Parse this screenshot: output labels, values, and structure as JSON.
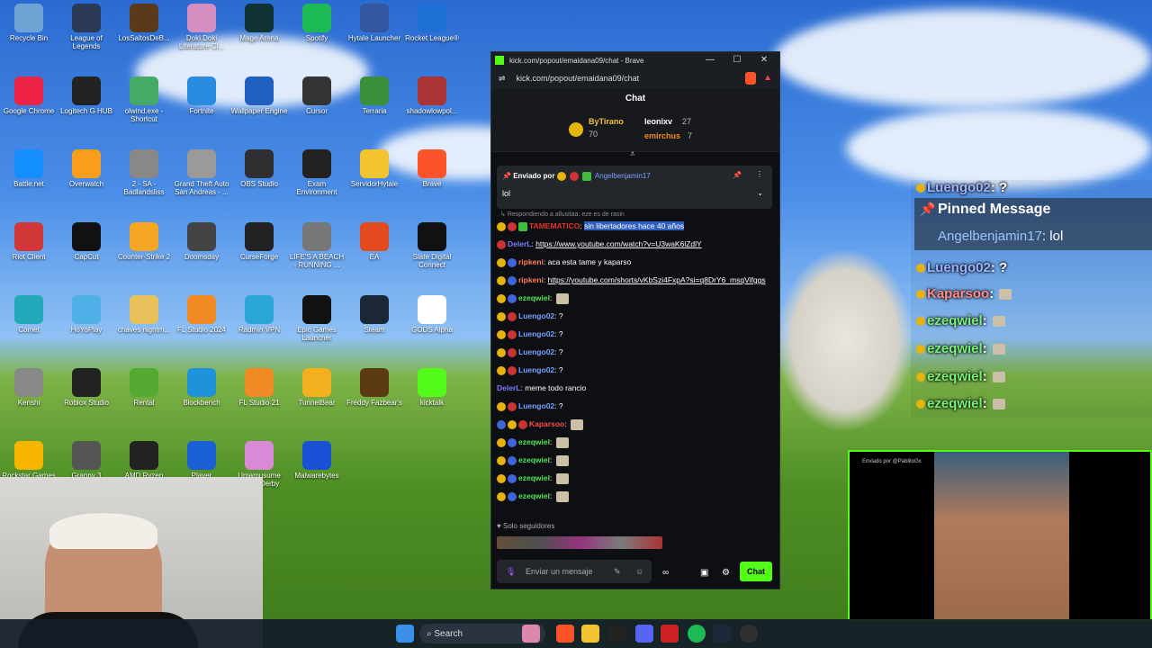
{
  "desktop": {
    "icons": [
      {
        "label": "Recycle Bin",
        "color": "#6fa3d6"
      },
      {
        "label": "League of Legends",
        "color": "#2b3b55"
      },
      {
        "label": "LosSaltosDeB...",
        "color": "#5b3a1a"
      },
      {
        "label": "Doki Doki Literature Cl...",
        "color": "#d48fc0"
      },
      {
        "label": "Mage Arena",
        "color": "#133"
      },
      {
        "label": "Spotify",
        "color": "#1db954"
      },
      {
        "label": "Hytale Launcher",
        "color": "#3557a0"
      },
      {
        "label": "Rocket League®",
        "color": "#1e6fd6"
      },
      {
        "label": "Google Chrome",
        "color": "#e24"
      },
      {
        "label": "Logitech G HUB",
        "color": "#222"
      },
      {
        "label": "olwind.exe - Shortcut",
        "color": "#4a6"
      },
      {
        "label": "Fortnite",
        "color": "#2a8ce0"
      },
      {
        "label": "Wallpaper Engine",
        "color": "#1f5fbf"
      },
      {
        "label": "Cursor",
        "color": "#333"
      },
      {
        "label": "Terraria",
        "color": "#3a8f3a"
      },
      {
        "label": "shadowlowpol...",
        "color": "#a33"
      },
      {
        "label": "Battle.net",
        "color": "#148eff"
      },
      {
        "label": "Overwatch",
        "color": "#f99e1a"
      },
      {
        "label": "2 - SA - Badlandsliss",
        "color": "#888"
      },
      {
        "label": "Grand Theft Auto San Andreas - ...",
        "color": "#9a9a9a"
      },
      {
        "label": "OBS Studio",
        "color": "#302e31"
      },
      {
        "label": "Exam Environment",
        "color": "#222"
      },
      {
        "label": "ServidorHytale",
        "color": "#f4c430"
      },
      {
        "label": "Brave",
        "color": "#fb542b"
      },
      {
        "label": "Riot Client",
        "color": "#d13639"
      },
      {
        "label": "CapCut",
        "color": "#111"
      },
      {
        "label": "Counter-Strike 2",
        "color": "#f5a623"
      },
      {
        "label": "Doomsday",
        "color": "#444"
      },
      {
        "label": "CurseForge",
        "color": "#222"
      },
      {
        "label": "LIFE'S A BEACH - RUNNING ...",
        "color": "#777"
      },
      {
        "label": "EA",
        "color": "#e34a1d"
      },
      {
        "label": "Slate Digital Connect",
        "color": "#111"
      },
      {
        "label": "Comet",
        "color": "#2ab"
      },
      {
        "label": "HoYoPlay",
        "color": "#4fb0e8"
      },
      {
        "label": "chaves nightm...",
        "color": "#e8c15a"
      },
      {
        "label": "FL Studio 2024",
        "color": "#f08a24"
      },
      {
        "label": "Radmin VPN",
        "color": "#2aa7d9"
      },
      {
        "label": "Epic Games Launcher",
        "color": "#111"
      },
      {
        "label": "Steam",
        "color": "#1b2838"
      },
      {
        "label": "GODS Alpha",
        "color": "#fff"
      },
      {
        "label": "Kenshi",
        "color": "#888"
      },
      {
        "label": "Roblox Studio",
        "color": "#222"
      },
      {
        "label": "Rental",
        "color": "#5a3"
      },
      {
        "label": "Blockbench",
        "color": "#1e93d9"
      },
      {
        "label": "FL Studio 21",
        "color": "#f08a24"
      },
      {
        "label": "TunnelBear",
        "color": "#f2b01e"
      },
      {
        "label": "Freddy Fazbear's",
        "color": "#5a3b12"
      },
      {
        "label": "kicktalk",
        "color": "#53fc18"
      },
      {
        "label": "Rockstar Games Launcher",
        "color": "#f7b500"
      },
      {
        "label": "Granny 3",
        "color": "#555"
      },
      {
        "label": "AMD Ryzen Master",
        "color": "#222"
      },
      {
        "label": "Player",
        "color": "#1a5fd6"
      },
      {
        "label": "Umamusume Pretty Derby",
        "color": "#d98ad6"
      },
      {
        "label": "Malwarebytes",
        "color": "#1a4fd6"
      }
    ]
  },
  "taskbar": {
    "search_placeholder": "Search"
  },
  "browser": {
    "window_title": "kick.com/popout/emaidana09/chat - Brave",
    "url": "kick.com/popout/emaidana09/chat",
    "minimize": "—",
    "maximize": "☐",
    "close": "✕"
  },
  "chat": {
    "header": "Chat",
    "leaderboard": {
      "first_name": "ByTirano",
      "first_count": "70",
      "second_name": "leonixv",
      "second_count": "27",
      "third_name": "emirchus",
      "third_count": "7"
    },
    "pinned": {
      "sent_by_label": "Enviado por",
      "user": "Angelbenjamin17",
      "text": "lol"
    },
    "reply_hint": "Respondiendo a allusitaa: eze es de rasin",
    "messages": [
      {
        "user": "TAMEMATICO",
        "user_color": "#e2342f",
        "text": "sin libertadores hace 40 años",
        "badges": [
          "gold",
          "red",
          "green"
        ]
      },
      {
        "user": "DelerL",
        "user_color": "#7b7bff",
        "text": "https://www.youtube.com/watch?v=U3waK6lZdlY",
        "badges": [
          "emote"
        ]
      },
      {
        "user": "ripkeni",
        "user_color": "#ff7a5a",
        "text": "aca esta tame y kaparso",
        "badges": [
          "gold",
          "blue"
        ]
      },
      {
        "user": "ripkeni",
        "user_color": "#ff7a5a",
        "text": "https://youtube.com/shorts/vKbSzi4FxpA?si=q8DrY6_msqVifggs",
        "badges": [
          "gold",
          "blue"
        ]
      },
      {
        "user": "ezeqwiel",
        "user_color": "#54e35c",
        "text": "",
        "badges": [
          "gold",
          "blue"
        ]
      },
      {
        "user": "Luengo02",
        "user_color": "#79a3ff",
        "text": "?",
        "badges": [
          "gold",
          "red"
        ]
      },
      {
        "user": "Luengo02",
        "user_color": "#79a3ff",
        "text": "?",
        "badges": [
          "gold",
          "red"
        ]
      },
      {
        "user": "Luengo02",
        "user_color": "#79a3ff",
        "text": "?",
        "badges": [
          "gold",
          "red"
        ]
      },
      {
        "user": "Luengo02",
        "user_color": "#79a3ff",
        "text": "?",
        "badges": [
          "gold",
          "red"
        ]
      },
      {
        "user": "DelerL",
        "user_color": "#7b7bff",
        "text": "meme todo rancio",
        "badges": []
      },
      {
        "user": "Luengo02",
        "user_color": "#79a3ff",
        "text": "?",
        "badges": [
          "gold",
          "red"
        ]
      },
      {
        "user": "Kaparsoo",
        "user_color": "#ff4a4a",
        "text": "",
        "badges": [
          "blue",
          "gold",
          "red"
        ]
      },
      {
        "user": "ezeqwiel",
        "user_color": "#54e35c",
        "text": "",
        "badges": [
          "gold",
          "blue"
        ]
      },
      {
        "user": "ezeqwiel",
        "user_color": "#54e35c",
        "text": "",
        "badges": [
          "gold",
          "blue"
        ]
      },
      {
        "user": "ezeqwiel",
        "user_color": "#54e35c",
        "text": "",
        "badges": [
          "gold",
          "blue"
        ]
      },
      {
        "user": "ezeqwiel",
        "user_color": "#54e35c",
        "text": "",
        "badges": [
          "gold",
          "blue"
        ]
      }
    ],
    "followers_only": "Solo seguidores",
    "input_placeholder": "Enviar un mensaje",
    "send_label": "Chat"
  },
  "overlay": {
    "pinned_title": "Pinned Message",
    "pinned_user": "Angelbenjamin17",
    "pinned_text": "lol",
    "rows": [
      {
        "user": "Luengo02",
        "text": "?",
        "color": "#9bb3ff"
      },
      {
        "user": "Luengo02",
        "text": "?",
        "color": "#9bb3ff"
      },
      {
        "user": "Kaparsoo",
        "text": "",
        "color": "#ff8a8a"
      },
      {
        "user": "ezeqwiel",
        "text": "",
        "color": "#78f078"
      },
      {
        "user": "ezeqwiel",
        "text": "",
        "color": "#78f078"
      },
      {
        "user": "ezeqwiel",
        "text": "",
        "color": "#78f078"
      },
      {
        "user": "ezeqwiel",
        "text": "",
        "color": "#78f078"
      }
    ],
    "cam_sent_by": "Enviado por @PablitoGx"
  }
}
